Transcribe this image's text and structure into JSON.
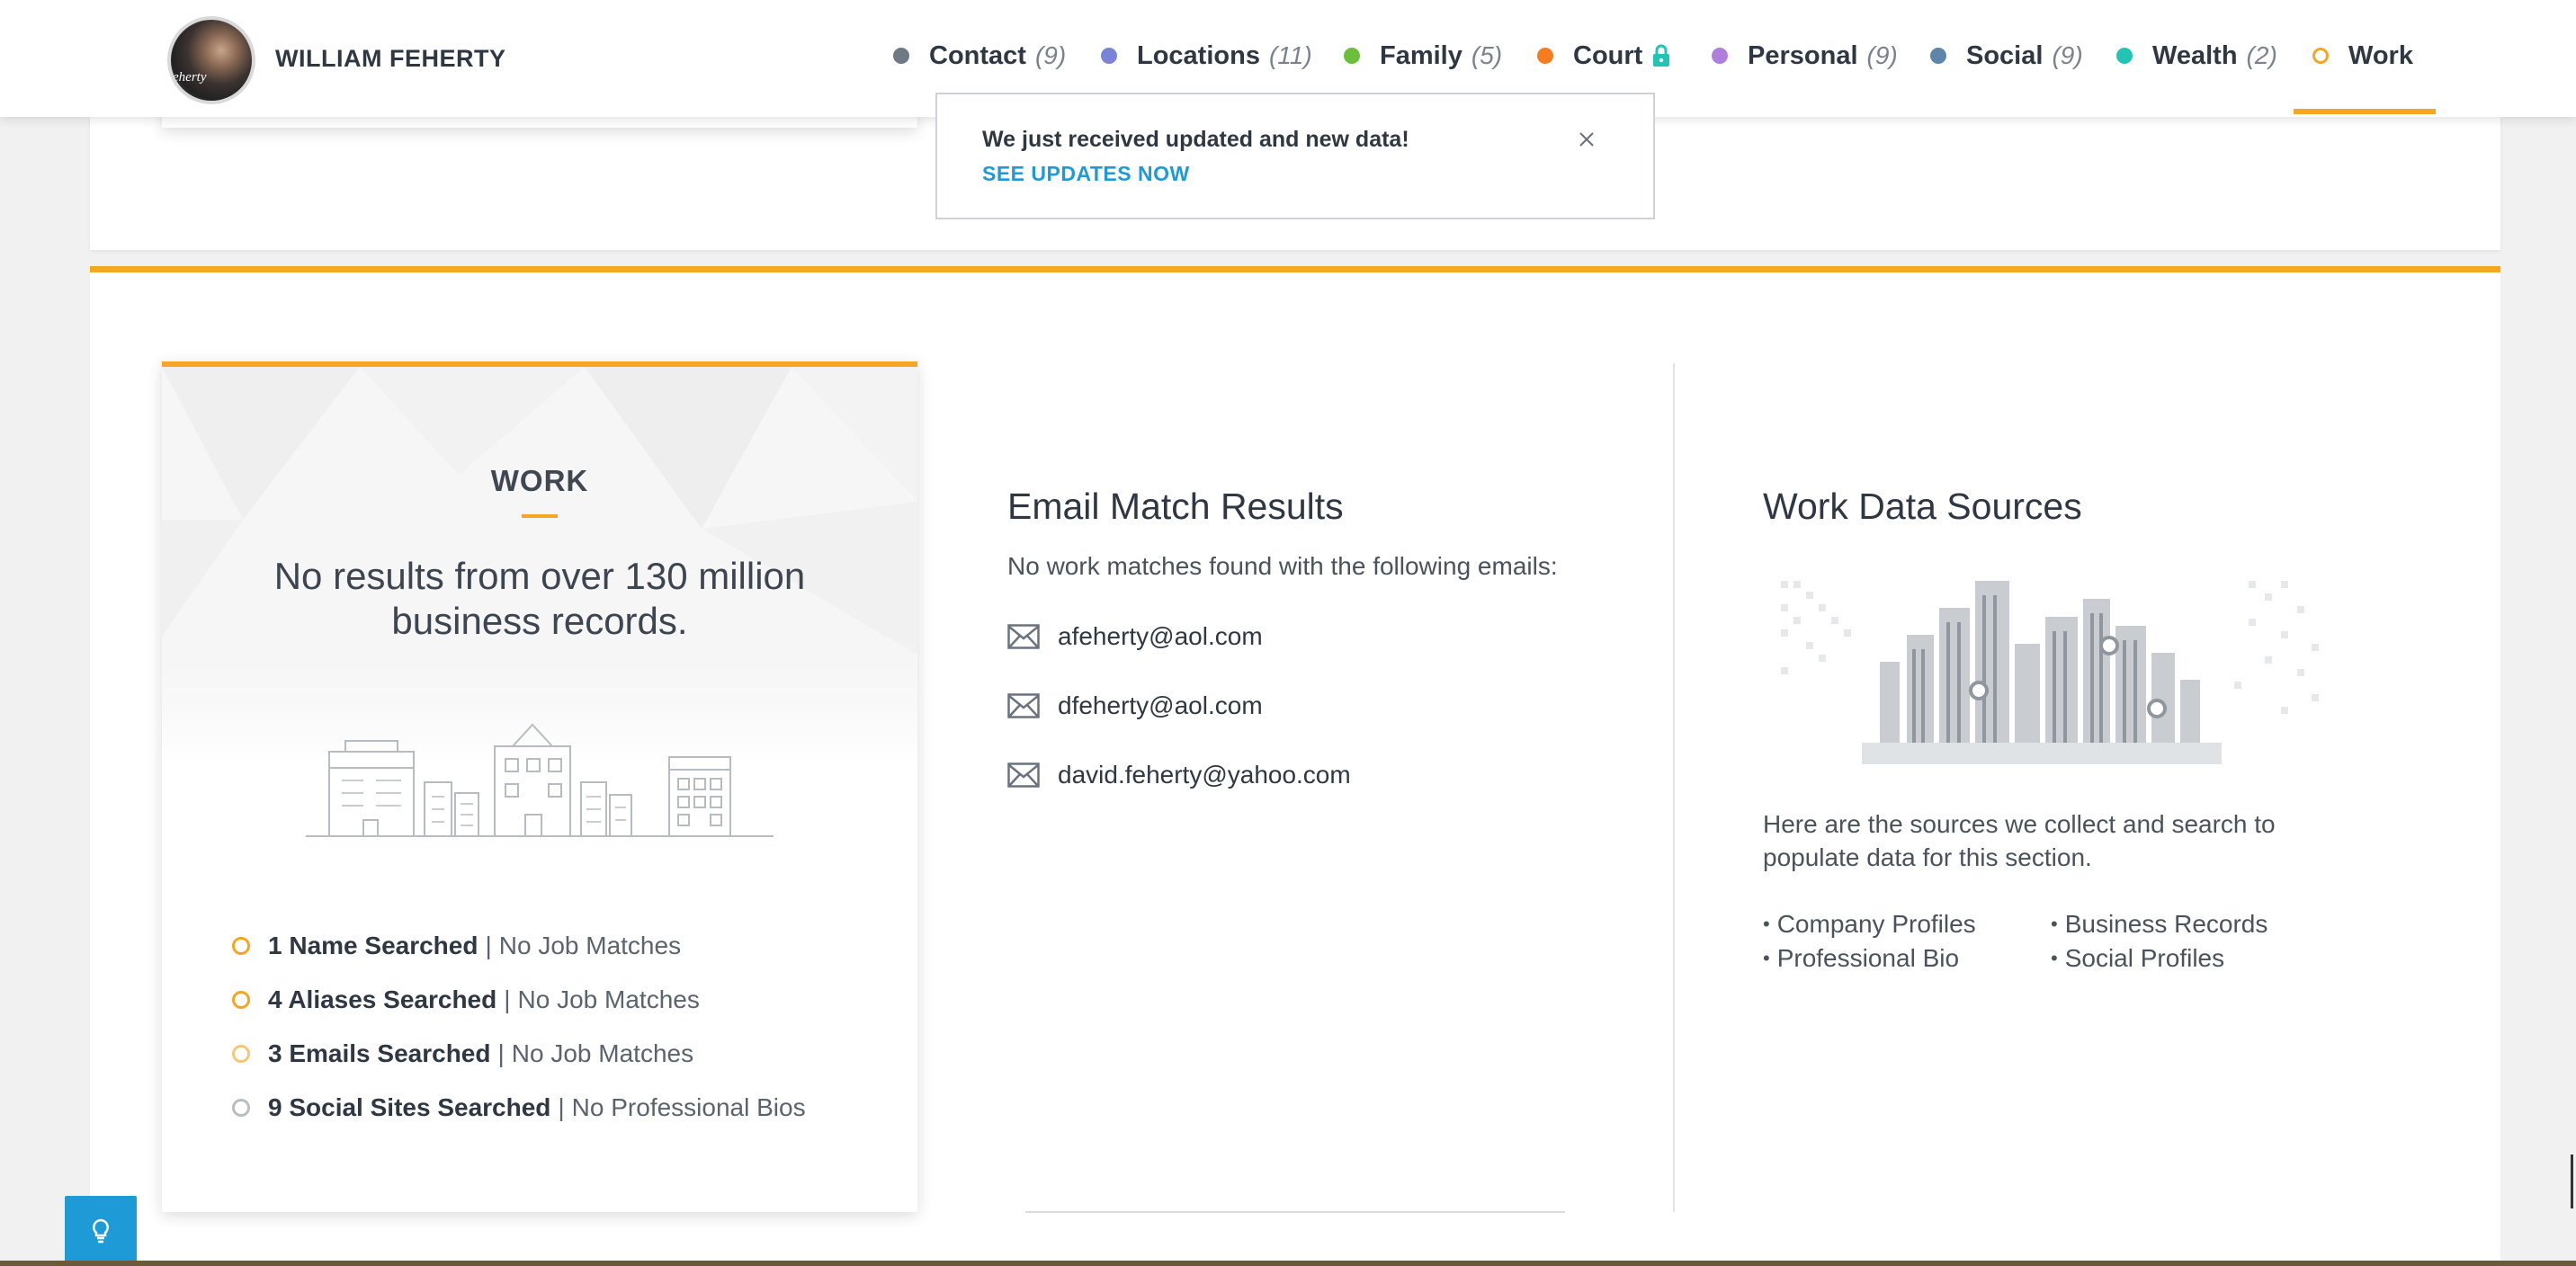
{
  "profile": {
    "name": "WILLIAM FEHERTY",
    "avatar_text": "eherty"
  },
  "nav": {
    "items": [
      {
        "label": "Contact",
        "count": "(9)",
        "color": "#6f7883"
      },
      {
        "label": "Locations",
        "count": "(11)",
        "color": "#7b83d9"
      },
      {
        "label": "Family",
        "count": "(5)",
        "color": "#6bbf3a"
      },
      {
        "label": "Court",
        "count": "",
        "color": "#f57c1f",
        "icon": "lock-icon"
      },
      {
        "label": "Personal",
        "count": "(9)",
        "color": "#b07fdb"
      },
      {
        "label": "Social",
        "count": "(9)",
        "color": "#5f86a8"
      },
      {
        "label": "Wealth",
        "count": "(2)",
        "color": "#22c4b4"
      },
      {
        "label": "Work",
        "count": "",
        "color": "#f5a623",
        "active": true
      }
    ]
  },
  "toast": {
    "message": "We just received updated and new data!",
    "link": "SEE UPDATES NOW"
  },
  "work_card": {
    "heading": "WORK",
    "message": "No results from over 130 million business records.",
    "stats": [
      {
        "strong": "1 Name Searched",
        "rest": "No Job Matches",
        "ring_color": "#f5a623"
      },
      {
        "strong": "4 Aliases Searched",
        "rest": "No Job Matches",
        "ring_color": "#f5a623"
      },
      {
        "strong": "3 Emails Searched",
        "rest": "No Job Matches",
        "ring_color": "#f7c874"
      },
      {
        "strong": "9 Social Sites Searched",
        "rest": "No Professional Bios",
        "ring_color": "#b9bec4"
      }
    ],
    "separator": "|"
  },
  "email_results": {
    "title": "Email Match Results",
    "subtitle": "No work matches found with the following emails:",
    "emails": [
      "afeherty@aol.com",
      "dfeherty@aol.com",
      "david.feherty@yahoo.com"
    ]
  },
  "sources": {
    "title": "Work Data Sources",
    "description": "Here are the sources we collect and search to populate data for this section.",
    "items": [
      "Company Profiles",
      "Business Records",
      "Professional Bio",
      "Social Profiles"
    ]
  },
  "colors": {
    "accent": "#f5a623",
    "link": "#1e9bd7"
  }
}
